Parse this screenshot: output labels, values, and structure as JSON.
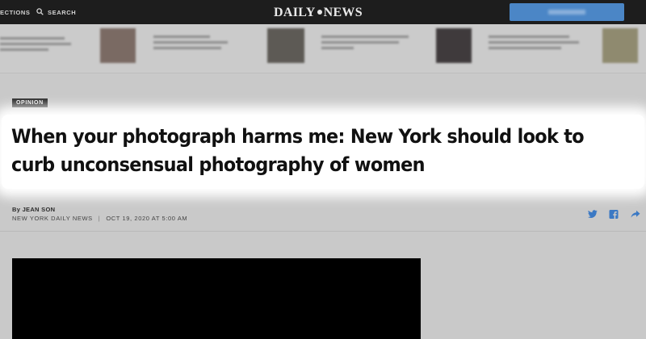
{
  "header": {
    "sections_label": "ECTIONS",
    "search_label": "SEARCH",
    "logo_left": "DAILY",
    "logo_right": "NEWS",
    "accent_color": "#4b86c6"
  },
  "article": {
    "category": "OPINION",
    "headline": "When your photograph harms me: New York should look to curb unconsensual photography of women",
    "byline": "By JEAN SON",
    "publication": "NEW YORK DAILY NEWS",
    "separator": "|",
    "timestamp": "OCT 19, 2020 AT 5:00 AM"
  },
  "share_icons": [
    "twitter-icon",
    "facebook-icon",
    "share-icon"
  ]
}
